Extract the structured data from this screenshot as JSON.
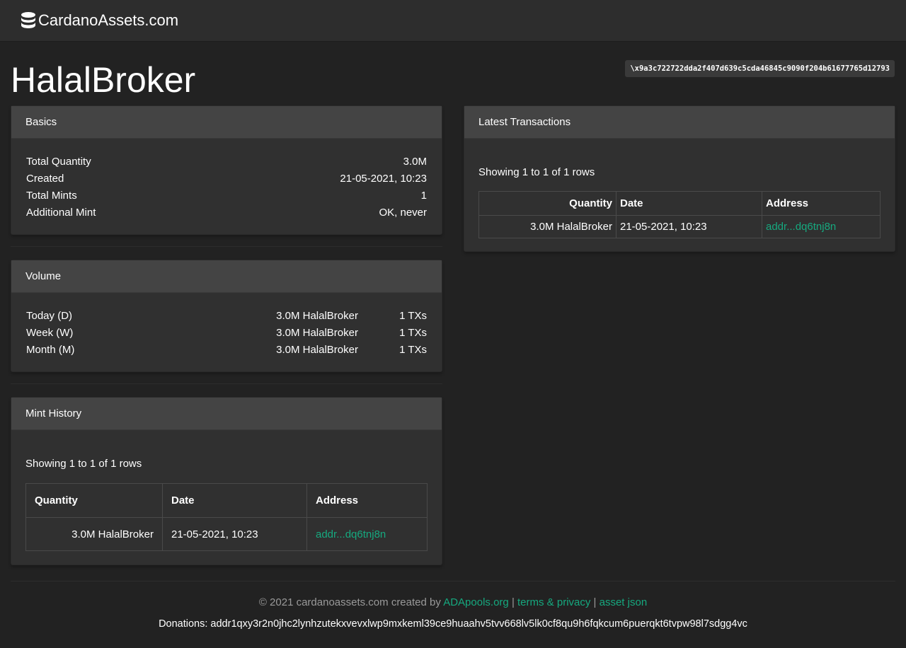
{
  "nav": {
    "brand": "CardanoAssets.com",
    "brand_icon": "database-icon"
  },
  "asset": {
    "name": "HalalBroker",
    "policy_id": "\\x9a3c722722dda2f407d639c5cda46845c9090f204b61677765d12793"
  },
  "basics": {
    "title": "Basics",
    "rows": [
      {
        "label": "Total Quantity",
        "value": "3.0M"
      },
      {
        "label": "Created",
        "value": "21-05-2021, 10:23"
      },
      {
        "label": "Total Mints",
        "value": "1"
      },
      {
        "label": "Additional Mint",
        "value": "OK, never"
      }
    ]
  },
  "volume": {
    "title": "Volume",
    "rows": [
      {
        "label": "Today (D)",
        "amount": "3.0M HalalBroker",
        "txs": "1 TXs"
      },
      {
        "label": "Week (W)",
        "amount": "3.0M HalalBroker",
        "txs": "1 TXs"
      },
      {
        "label": "Month (M)",
        "amount": "3.0M HalalBroker",
        "txs": "1 TXs"
      }
    ]
  },
  "mint_history": {
    "title": "Mint History",
    "showing": "Showing 1 to 1 of 1 rows",
    "columns": [
      "Quantity",
      "Date",
      "Address"
    ],
    "rows": [
      {
        "quantity": "3.0M HalalBroker",
        "date": "21-05-2021, 10:23",
        "address": "addr...dq6tnj8n"
      }
    ]
  },
  "latest_transactions": {
    "title": "Latest Transactions",
    "showing": "Showing 1 to 1 of 1 rows",
    "columns": [
      "Quantity",
      "Date",
      "Address"
    ],
    "rows": [
      {
        "quantity": "3.0M HalalBroker",
        "date": "21-05-2021, 10:23",
        "address": "addr...dq6tnj8n"
      }
    ]
  },
  "footer": {
    "copyright": "© 2021 cardanoassets.com created by",
    "adapools_link": "ADApools.org",
    "separator": "|",
    "terms_link": "terms & privacy",
    "asset_json_link": "asset json",
    "donations": "Donations: addr1qxy3r2n0jhc2lynhzutekxvevxlwp9mxkeml39ce9huaahv5tvv668lv5lk0cf8qu9h6fqkcum6puerqkt6tvpw98l7sdgg4vc"
  },
  "colors": {
    "accent": "#16a97f",
    "background": "#222222",
    "card": "#303030",
    "card_header": "#444444"
  }
}
